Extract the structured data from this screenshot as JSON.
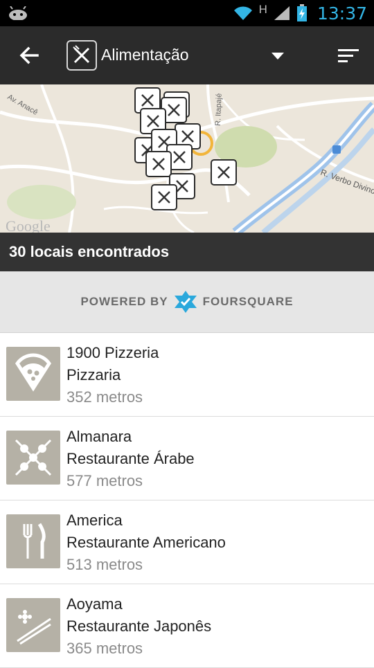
{
  "status": {
    "time": "13:37",
    "network": "H"
  },
  "actionbar": {
    "category_label": "Alimentação"
  },
  "map": {
    "street_labels": [
      "Av. Anacê",
      "R. Itapajé",
      "R. Verbo Divino"
    ],
    "watermark": "Google"
  },
  "results": {
    "count_label": "30 locais encontrados"
  },
  "foursquare": {
    "powered": "POWERED BY",
    "brand": "FOURSQUARE"
  },
  "places": [
    {
      "name": "1900 Pizzeria",
      "category": "Pizzaria",
      "distance": "352 metros",
      "icon": "pizza-icon"
    },
    {
      "name": "Almanara",
      "category": "Restaurante Árabe",
      "distance": "577 metros",
      "icon": "kebab-icon"
    },
    {
      "name": "America",
      "category": "Restaurante Americano",
      "distance": "513 metros",
      "icon": "fork-knife-icon"
    },
    {
      "name": "Aoyama",
      "category": "Restaurante Japonês",
      "distance": "365 metros",
      "icon": "chopsticks-icon"
    }
  ]
}
